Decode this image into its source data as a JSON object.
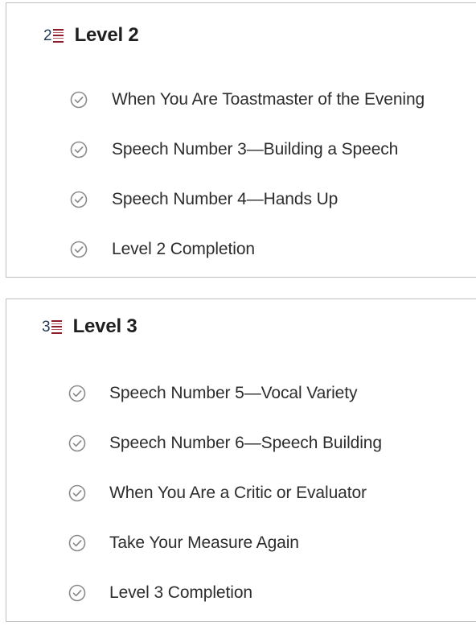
{
  "levels": [
    {
      "number": "2",
      "title": "Level 2",
      "items": [
        {
          "label": "When You Are Toastmaster of the Evening"
        },
        {
          "label": "Speech Number 3—Building a Speech"
        },
        {
          "label": "Speech Number 4—Hands Up"
        },
        {
          "label": "Level 2 Completion"
        }
      ]
    },
    {
      "number": "3",
      "title": "Level 3",
      "items": [
        {
          "label": "Speech Number 5—Vocal Variety"
        },
        {
          "label": "Speech Number 6—Speech Building"
        },
        {
          "label": "When You Are a Critic or Evaluator"
        },
        {
          "label": "Take Your Measure Again"
        },
        {
          "label": "Level 3 Completion"
        }
      ]
    }
  ],
  "icons": {
    "level_icon": "numbered-list-icon",
    "item_icon": "check-circle-icon"
  },
  "colors": {
    "level_number": "#1f3b57",
    "level_lines": "#8c1c2c",
    "check_icon": "#8a8a8a",
    "border": "#bfbfbf"
  }
}
